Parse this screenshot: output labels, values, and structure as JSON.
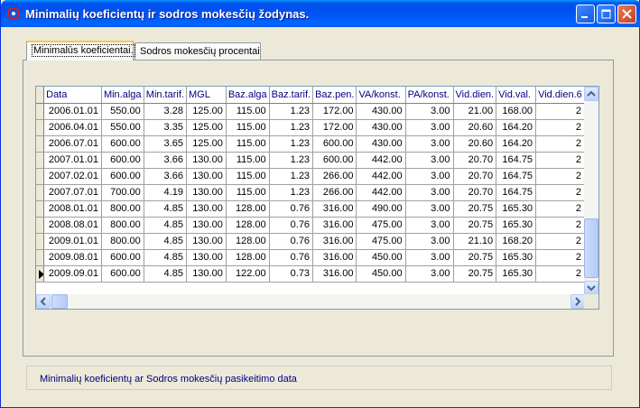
{
  "window": {
    "title": "Minimalių koeficientų ir sodros mokesčių žodynas."
  },
  "tabs": [
    {
      "label": "Minimalūs koeficientai.",
      "active": true
    },
    {
      "label": "Sodros mokesčių procentai",
      "active": false
    }
  ],
  "grid": {
    "columns": [
      "Data",
      "Min.alga",
      "Min.tarif.",
      "MGL",
      "Baz.alga",
      "Baz.tarif.",
      "Baz.pen.",
      "VA/konst.",
      "PA/konst.",
      "Vid.dien.",
      "Vid.val.",
      "Vid.dien.6"
    ],
    "rows": [
      [
        "2006.01.01",
        "550.00",
        "3.28",
        "125.00",
        "115.00",
        "1.23",
        "172.00",
        "430.00",
        "3.00",
        "21.00",
        "168.00",
        "2"
      ],
      [
        "2006.04.01",
        "550.00",
        "3.35",
        "125.00",
        "115.00",
        "1.23",
        "172.00",
        "430.00",
        "3.00",
        "20.60",
        "164.20",
        "2"
      ],
      [
        "2006.07.01",
        "600.00",
        "3.65",
        "125.00",
        "115.00",
        "1.23",
        "600.00",
        "430.00",
        "3.00",
        "20.60",
        "164.20",
        "2"
      ],
      [
        "2007.01.01",
        "600.00",
        "3.66",
        "130.00",
        "115.00",
        "1.23",
        "600.00",
        "442.00",
        "3.00",
        "20.70",
        "164.75",
        "2"
      ],
      [
        "2007.02.01",
        "600.00",
        "3.66",
        "130.00",
        "115.00",
        "1.23",
        "266.00",
        "442.00",
        "3.00",
        "20.70",
        "164.75",
        "2"
      ],
      [
        "2007.07.01",
        "700.00",
        "4.19",
        "130.00",
        "115.00",
        "1.23",
        "266.00",
        "442.00",
        "3.00",
        "20.70",
        "164.75",
        "2"
      ],
      [
        "2008.01.01",
        "800.00",
        "4.85",
        "130.00",
        "128.00",
        "0.76",
        "316.00",
        "490.00",
        "3.00",
        "20.75",
        "165.30",
        "2"
      ],
      [
        "2008.08.01",
        "800.00",
        "4.85",
        "130.00",
        "128.00",
        "0.76",
        "316.00",
        "475.00",
        "3.00",
        "20.75",
        "165.30",
        "2"
      ],
      [
        "2009.01.01",
        "800.00",
        "4.85",
        "130.00",
        "128.00",
        "0.76",
        "316.00",
        "475.00",
        "3.00",
        "21.10",
        "168.20",
        "2"
      ],
      [
        "2009.08.01",
        "600.00",
        "4.85",
        "130.00",
        "128.00",
        "0.76",
        "316.00",
        "450.00",
        "3.00",
        "20.75",
        "165.30",
        "2"
      ],
      [
        "2009.09.01",
        "600.00",
        "4.85",
        "130.00",
        "122.00",
        "0.73",
        "316.00",
        "450.00",
        "3.00",
        "20.75",
        "165.30",
        "2"
      ]
    ],
    "current_row": 10
  },
  "status": {
    "text": "Minimalių koeficientų ar Sodros mokesčių pasikeitimo data"
  },
  "colors": {
    "title_bar": "#0054e3",
    "header_text": "#000080",
    "close_button": "#d94f2c"
  }
}
